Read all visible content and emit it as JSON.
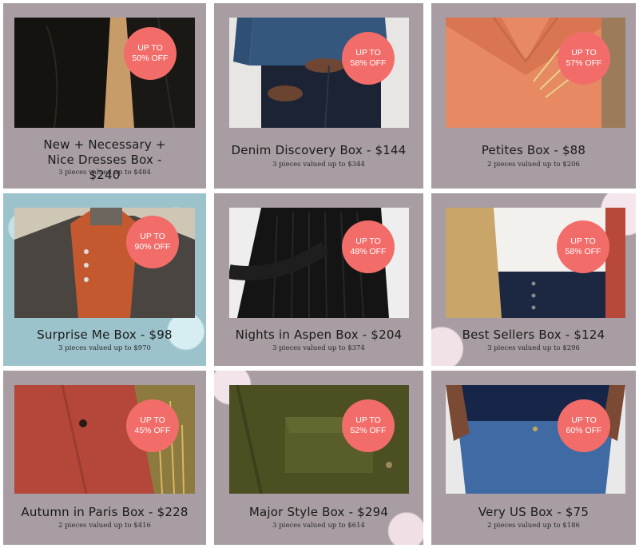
{
  "boxes": [
    {
      "title": "New + Necessary + Nice Dresses Box - $240",
      "subtitle": "3 pieces valued up to $484",
      "badge_line1": "UP TO",
      "badge_line2": "50% OFF",
      "image": "black-dress-photo"
    },
    {
      "title": "Denim Discovery Box - $144",
      "subtitle": "3 pieces valued up to $344",
      "badge_line1": "UP TO",
      "badge_line2": "58% OFF",
      "image": "denim-shirt-jeans-photo"
    },
    {
      "title": "Petites Box - $88",
      "subtitle": "2 pieces valued up to $206",
      "badge_line1": "UP TO",
      "badge_line2": "57% OFF",
      "image": "orange-vneck-tee-photo"
    },
    {
      "title": "Surprise Me Box - $98",
      "subtitle": "3 pieces valued up to $970",
      "badge_line1": "UP TO",
      "badge_line2": "90% OFF",
      "image": "leather-jacket-knit-polo-photo"
    },
    {
      "title": "Nights in Aspen Box - $204",
      "subtitle": "3 pieces valued up to $374",
      "badge_line1": "UP TO",
      "badge_line2": "48% OFF",
      "image": "black-ribbed-sweater-photo"
    },
    {
      "title": "Best Sellers Box - $124",
      "subtitle": "3 pieces valued up to $296",
      "badge_line1": "UP TO",
      "badge_line2": "58% OFF",
      "image": "camel-blazer-jeans-photo"
    },
    {
      "title": "Autumn in Paris Box - $228",
      "subtitle": "2 pieces valued up to $416",
      "badge_line1": "UP TO",
      "badge_line2": "45% OFF",
      "image": "rust-coat-photo"
    },
    {
      "title": "Major Style Box - $294",
      "subtitle": "3 pieces valued up to $614",
      "badge_line1": "UP TO",
      "badge_line2": "52% OFF",
      "image": "olive-utility-jacket-photo"
    },
    {
      "title": "Very US Box - $75",
      "subtitle": "2 pieces valued up to $186",
      "badge_line1": "UP TO",
      "badge_line2": "60% OFF",
      "image": "navy-top-jeans-photo"
    }
  ],
  "colors": {
    "card_bg": "#a79da3",
    "badge": "#f26d6a",
    "title": "#1a1a1a"
  }
}
